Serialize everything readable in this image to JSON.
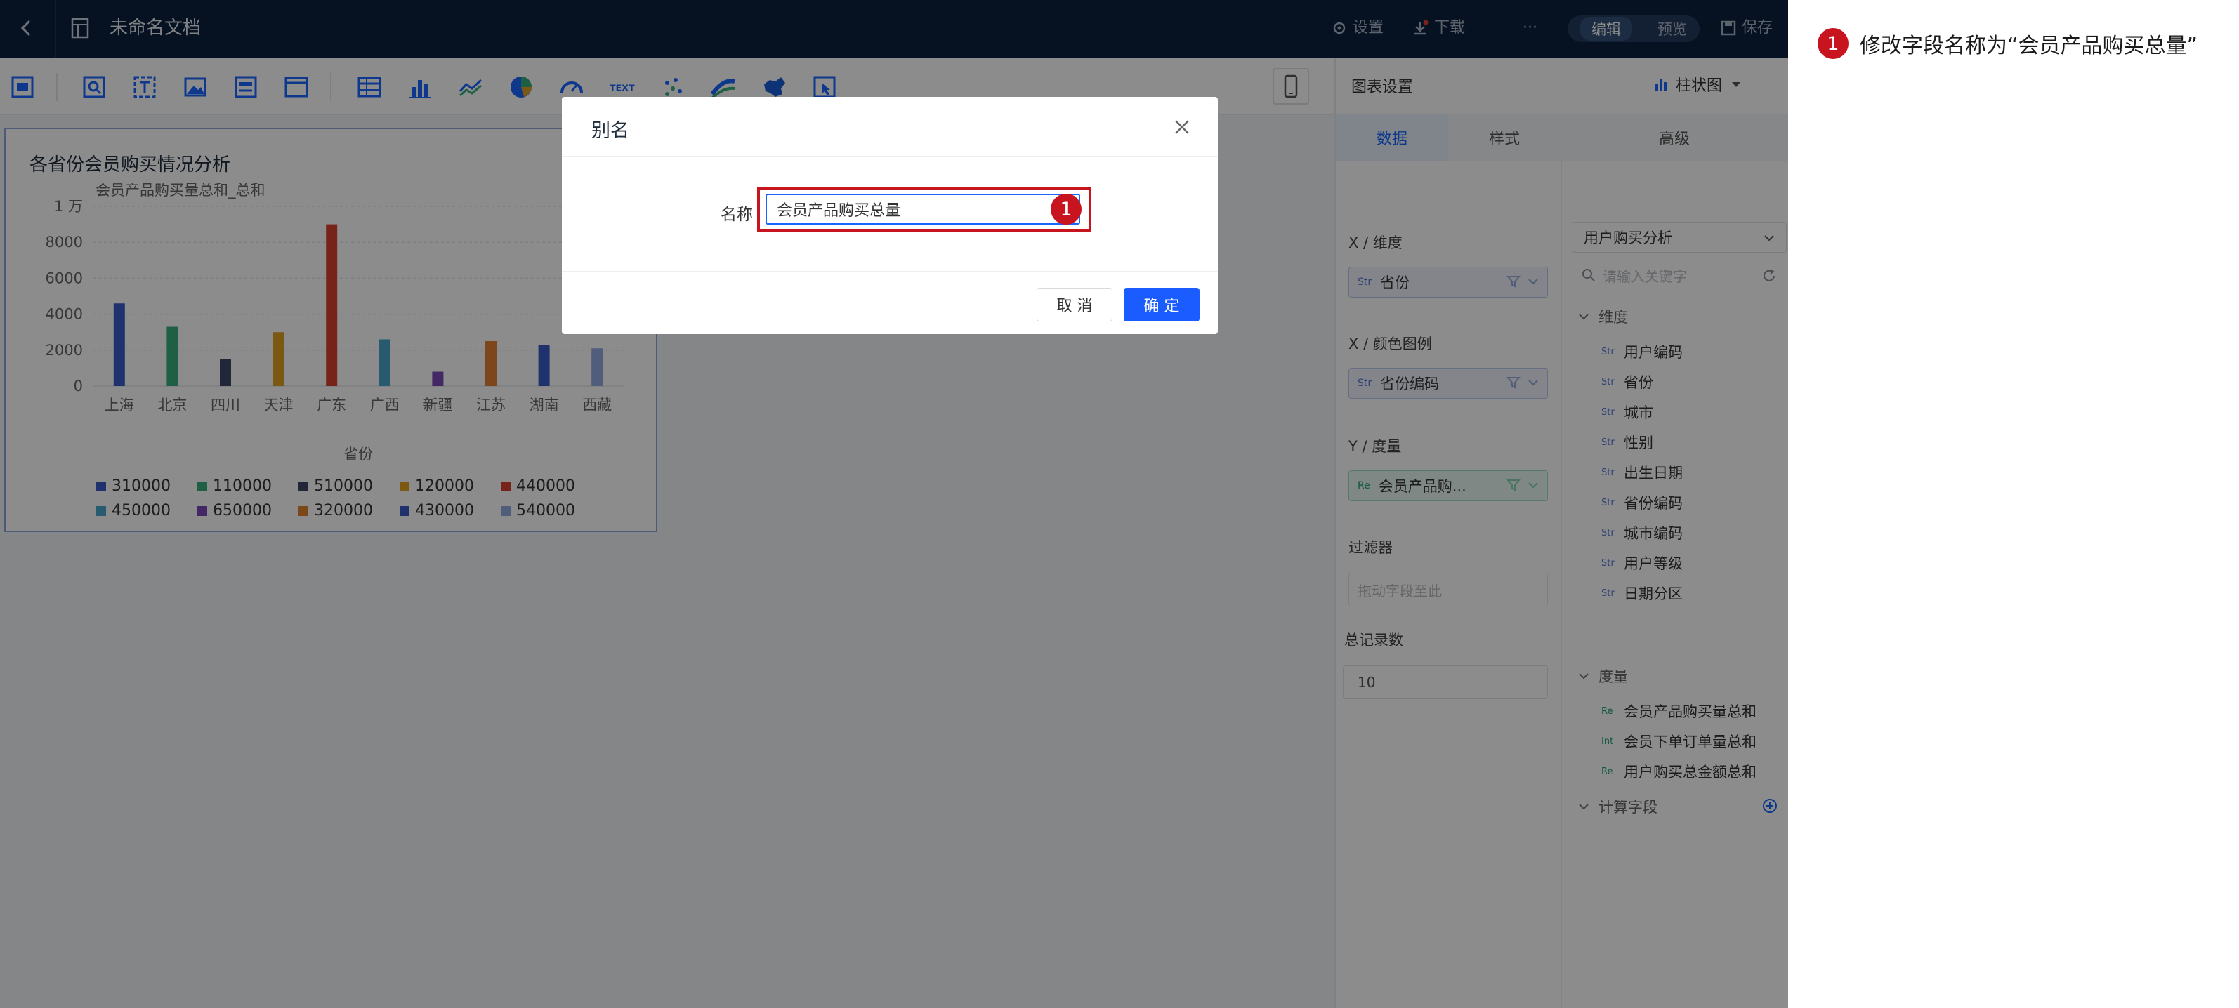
{
  "topbar": {
    "doc_title": "未命名文档",
    "actions": {
      "settings": "设置",
      "download": "下载",
      "more": "···",
      "save": "保存"
    },
    "mode_edit": "编辑",
    "mode_preview": "预览"
  },
  "toolbar": {
    "tools": [
      "layout-icon",
      "query-icon",
      "text-box-icon",
      "image-icon",
      "component-icon",
      "window-icon",
      "table-icon",
      "bar-chart-icon",
      "line-chart-icon",
      "pie-chart-icon",
      "gauge-icon",
      "text-icon",
      "scatter-icon",
      "funnel-icon",
      "map-icon",
      "select-icon"
    ],
    "text_tool_label": "TEXT"
  },
  "chart": {
    "title": "各省份会员购买情况分析"
  },
  "chart_data": {
    "type": "bar",
    "title": "各省份会员购买情况分析",
    "ylabel": "会员产品购买量总和_总和",
    "xlabel": "省份",
    "categories": [
      "上海",
      "北京",
      "四川",
      "天津",
      "广东",
      "广西",
      "新疆",
      "江苏",
      "湖南",
      "西藏"
    ],
    "values": [
      4600,
      3300,
      1500,
      3000,
      9000,
      2600,
      800,
      2500,
      2300,
      2100
    ],
    "ylim": [
      0,
      10000
    ],
    "yticks": [
      0,
      2000,
      4000,
      6000,
      8000,
      10000
    ],
    "ytick_labels": [
      "0",
      "2000",
      "4000",
      "6000",
      "8000",
      "1 万"
    ],
    "colors": [
      "#3b5bc8",
      "#3aae7b",
      "#3d4766",
      "#e2a322",
      "#d8422f",
      "#4aa5cc",
      "#7b4ab8",
      "#e38233",
      "#3b5bc8",
      "#93abe0"
    ],
    "legend": [
      "310000",
      "110000",
      "510000",
      "120000",
      "440000",
      "450000",
      "650000",
      "320000",
      "430000",
      "540000"
    ],
    "grid": true,
    "legend_position": "bottom"
  },
  "panel": {
    "title": "图表设置",
    "chart_type": "柱状图",
    "tabs": [
      "数据",
      "样式",
      "高级"
    ],
    "active_tab": 0,
    "x_dimension_label": "X / 维度",
    "x_dimension_field": "省份",
    "x_color_label": "X / 颜色图例",
    "x_color_field": "省份编码",
    "y_measure_label": "Y / 度量",
    "y_measure_field": "会员产品购...",
    "filter_label": "过滤器",
    "filter_placeholder": "拖动字段至此",
    "total_label": "总记录数",
    "total_value": "10",
    "dataset": "用户购买分析",
    "search_placeholder": "请输入关键字",
    "dim_group": "维度",
    "dims": [
      "用户编码",
      "省份",
      "城市",
      "性别",
      "出生日期",
      "省份编码",
      "城市编码",
      "用户等级",
      "日期分区"
    ],
    "measure_group": "度量",
    "measures": [
      {
        "tag": "Re",
        "name": "会员产品购买量总和"
      },
      {
        "tag": "Int",
        "name": "会员下单订单量总和"
      },
      {
        "tag": "Re",
        "name": "用户购买总金额总和"
      }
    ],
    "calc_group": "计算字段",
    "dim_tag": "Str"
  },
  "dialog": {
    "title": "别名",
    "name_label": "名称",
    "name_value": "会员产品购买总量",
    "cancel": "取 消",
    "ok": "确 定",
    "badge": "1"
  },
  "annotation": {
    "badge": "1",
    "text": "修改字段名称为“会员产品购买总量”"
  },
  "colors": {
    "topbar_bg": "#0c1f3d",
    "primary": "#1a5cff",
    "highlight": "#c8141e"
  }
}
